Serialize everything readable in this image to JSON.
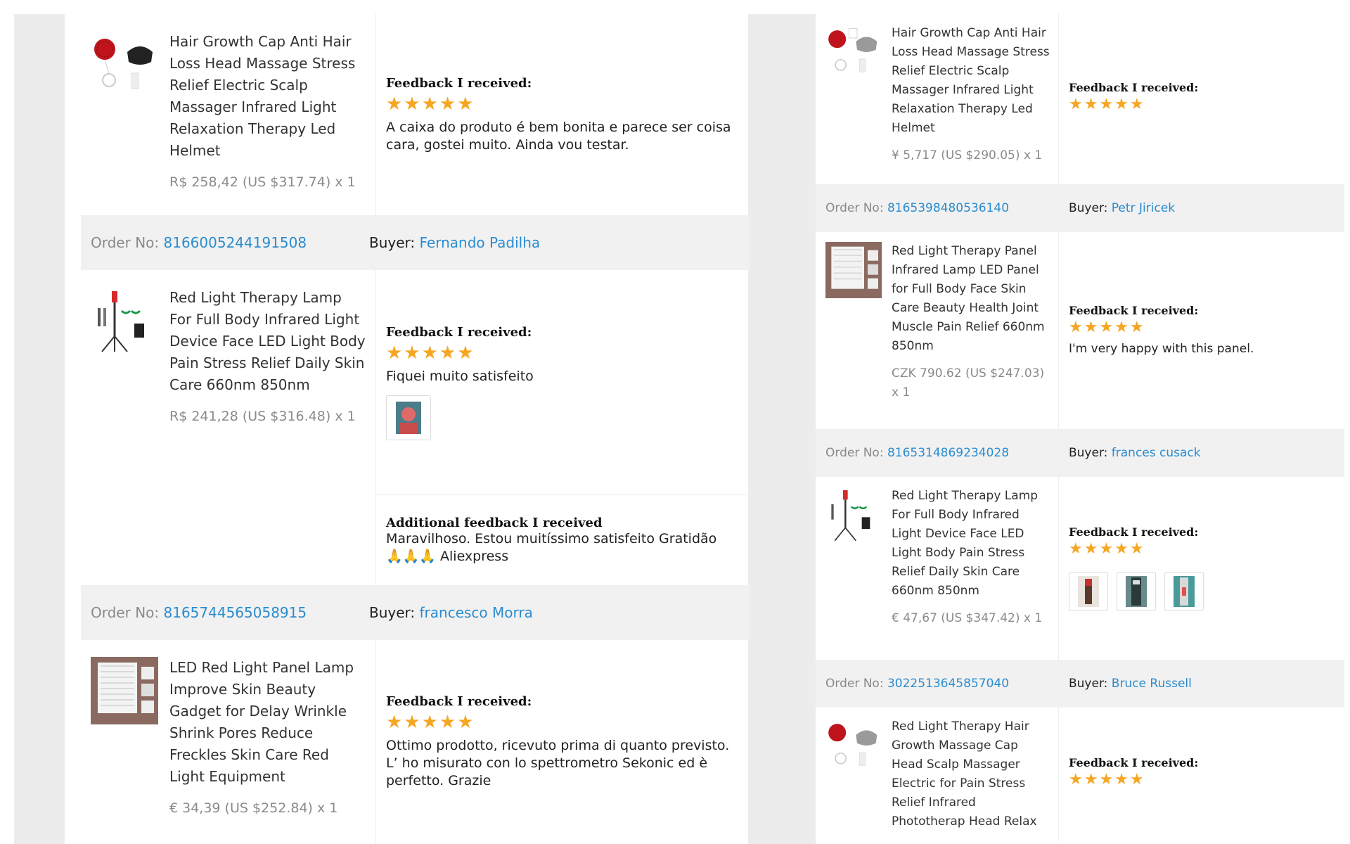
{
  "left": {
    "item1": {
      "title": "Hair Growth Cap Anti Hair Loss Head Massage Stress Relief Electric Scalp Massager Infrared Light Relaxation Therapy Led Helmet",
      "price": "R$ 258,42 (US $317.74) x 1",
      "feedback_label": "Feedback I received:",
      "stars": "★★★★★",
      "feedback": "A caixa do produto é bem bonita e parece ser coisa cara, gostei muito. Ainda vou testar."
    },
    "order1": {
      "order_label": "Order No:",
      "order_no": "8166005244191508",
      "buyer_label": "Buyer:",
      "buyer": "Fernando Padilha"
    },
    "item2": {
      "title": "Red Light Therapy Lamp For Full Body Infrared Light Device Face LED Light Body Pain Stress Relief Daily Skin Care 660nm 850nm",
      "price": "R$ 241,28 (US $316.48) x 1",
      "feedback_label": "Feedback I received:",
      "stars": "★★★★★",
      "feedback": "Fiquei muito satisfeito",
      "additional_label": "Additional feedback I received",
      "additional": "Maravilhoso. Estou muitíssimo satisfeito Gratidão",
      "additional_tail": "🙏🙏🙏 Aliexpress"
    },
    "order2": {
      "order_label": "Order No:",
      "order_no": "8165744565058915",
      "buyer_label": "Buyer:",
      "buyer": "francesco Morra"
    },
    "item3": {
      "title": "LED Red Light Panel Lamp Improve Skin Beauty Gadget for Delay Wrinkle Shrink Pores Reduce Freckles Skin Care Red Light Equipment",
      "price": "€ 34,39 (US $252.84) x 1",
      "feedback_label": "Feedback I received:",
      "stars": "★★★★★",
      "feedback": "Ottimo prodotto, ricevuto prima di quanto previsto. L’  ho misurato con lo spettrometro Sekonic ed è perfetto. Grazie"
    }
  },
  "right": {
    "item1": {
      "title": "Hair Growth Cap Anti Hair Loss Head Massage Stress Relief Electric Scalp Massager Infrared Light Relaxation Therapy Led Helmet",
      "price": "¥ 5,717 (US $290.05) x 1",
      "feedback_label": "Feedback I received:",
      "stars": "★★★★★"
    },
    "order1": {
      "order_label": "Order No:",
      "order_no": "8165398480536140",
      "buyer_label": "Buyer:",
      "buyer": "Petr Jiricek"
    },
    "item2": {
      "title": "Red Light Therapy Panel Infrared Lamp LED Panel for Full Body Face Skin Care Beauty Health Joint Muscle Pain Relief 660nm 850nm",
      "price": "CZK 790.62 (US $247.03) x 1",
      "feedback_label": "Feedback I received:",
      "stars": "★★★★★",
      "feedback": "I'm very happy with this panel."
    },
    "order2": {
      "order_label": "Order No:",
      "order_no": "8165314869234028",
      "buyer_label": "Buyer:",
      "buyer": "frances cusack"
    },
    "item3": {
      "title": "Red Light Therapy Lamp For Full Body Infrared Light Device Face LED Light Body Pain Stress Relief Daily Skin Care 660nm 850nm",
      "price": "€ 47,67 (US $347.42) x 1",
      "feedback_label": "Feedback I received:",
      "stars": "★★★★★"
    },
    "order3": {
      "order_label": "Order No:",
      "order_no": "3022513645857040",
      "buyer_label": "Buyer:",
      "buyer": "Bruce Russell"
    },
    "item4": {
      "title": "Red Light Therapy Hair Growth Massage Cap Head Scalp Massager Electric for Pain Stress Relief Infrared Phototherap Head Relax",
      "feedback_label": "Feedback I received:",
      "stars": "★★★★★"
    }
  },
  "icons": {
    "helmet": "helmet-icon",
    "lamp": "tripod-lamp-icon",
    "panel": "led-panel-icon",
    "photo": "review-photo-icon"
  },
  "colors": {
    "link": "#2a8ccf",
    "star": "#f5a623",
    "orderbar": "#f1f1f1",
    "gutter": "#ececec"
  }
}
